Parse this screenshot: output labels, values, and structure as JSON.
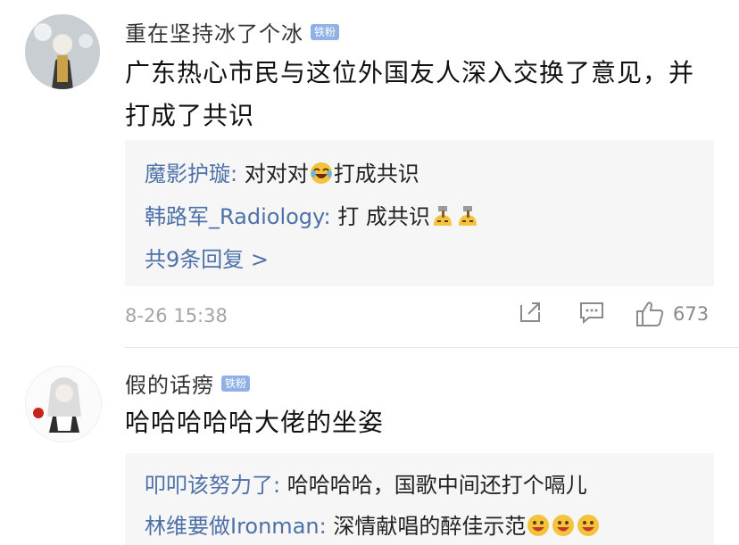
{
  "comments": [
    {
      "username": "重在坚持冰了个冰",
      "badge": "铁粉",
      "text": "广东热心市民与这位外国友人深入交换了意见，并打成了共识",
      "replies": [
        {
          "author": "魔影护璇",
          "sep": ": ",
          "text_before": "对对对",
          "emojis": [
            "laugh-cry-emoji"
          ],
          "text_after": "打成共识"
        },
        {
          "author": "韩路军_Radiology",
          "sep": ": ",
          "text_before": "打 成共识",
          "emojis": [
            "hammer-emoji",
            "hammer-emoji"
          ],
          "text_after": ""
        }
      ],
      "more_replies": "共9条回复 >",
      "timestamp": "8-26 15:38",
      "likes": "673"
    },
    {
      "username": "假的话痨",
      "badge": "铁粉",
      "text": "哈哈哈哈哈大佬的坐姿",
      "replies": [
        {
          "author": "叩叩该努力了",
          "sep": ": ",
          "text_before": "哈哈哈哈，国歌中间还打个嗝儿",
          "emojis": [],
          "text_after": ""
        },
        {
          "author": "林维要做Ironman",
          "sep": ": ",
          "text_before": "深情献唱的醉佳示范",
          "emojis": [
            "grin-emoji",
            "grin-emoji",
            "grin-emoji"
          ],
          "text_after": ""
        }
      ]
    }
  ],
  "colors": {
    "link_blue": "#4d71a8",
    "badge_blue": "#8fb1e6",
    "reply_bg": "#f6f6f6",
    "meta_gray": "#a5a5a5"
  },
  "icons": {
    "share": "share-icon",
    "comment": "comment-icon",
    "like": "thumbs-up-icon"
  }
}
